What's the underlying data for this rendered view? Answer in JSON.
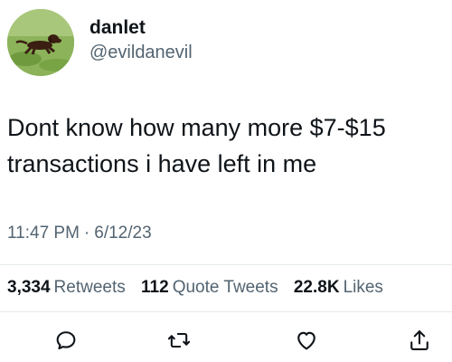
{
  "author": {
    "display_name": "danlet",
    "handle": "@evildanevil"
  },
  "tweet": {
    "text": "Dont know how many more $7-$15\ntransactions i have left in me",
    "time": "11:47 PM",
    "separator": "·",
    "date": "6/12/23"
  },
  "stats": {
    "retweets_count": "3,334",
    "retweets_label": "Retweets",
    "quotes_count": "112",
    "quotes_label": "Quote Tweets",
    "likes_count": "22.8K",
    "likes_label": "Likes"
  },
  "actions": [
    {
      "icon": "reply-icon"
    },
    {
      "icon": "retweet-icon"
    },
    {
      "icon": "like-heart-icon"
    },
    {
      "icon": "share-icon"
    }
  ],
  "colors": {
    "text_primary": "#0f1419",
    "text_secondary": "#536471",
    "divider": "#e6eaed",
    "background": "#ffffff"
  }
}
